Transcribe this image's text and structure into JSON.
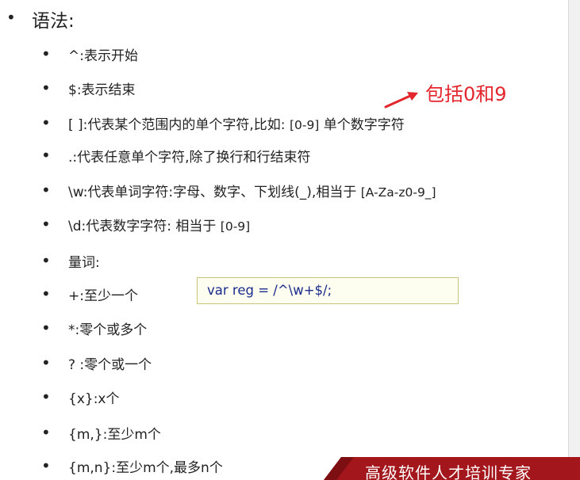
{
  "heading": "语法:",
  "items": [
    {
      "text": "^:表示开始"
    },
    {
      "text": "$:表示结束"
    },
    {
      "text": "[ ]:代表某个范围内的单个字符,比如:",
      "code": "[0-9]",
      "tail": " 单个数字字符"
    },
    {
      "text": ".:代表任意单个字符,除了换行和行结束符"
    },
    {
      "text": "\\w:代表单词字符:字母、数字、下划线(_),相当于 ",
      "code": "[A-Za-z0-9_]"
    },
    {
      "text": "\\d:代表数字字符: 相当于 ",
      "code": "[0-9]"
    },
    {
      "text": "量词:"
    },
    {
      "text": "+:至少一个"
    },
    {
      "text": "*:零个或多个"
    },
    {
      "text": "? :零个或一个"
    },
    {
      "text": "{x}:x个"
    },
    {
      "text": "{m,}:至少m个"
    },
    {
      "text": "{m,n}:至少m个,最多n个"
    }
  ],
  "code_box": "var reg = /^\\w+$/;",
  "annotation": "包括0和9",
  "banner": "高级软件人才培训专家",
  "colors": {
    "annotation": "#e3262d",
    "code_text": "#1a2b8c",
    "code_box_bg": "#fefef0",
    "banner_bg": "#a3161b"
  },
  "icons": {
    "annotation_arrow": "red-arrow-icon"
  }
}
